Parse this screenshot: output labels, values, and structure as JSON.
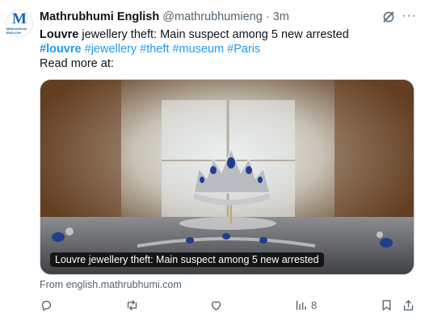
{
  "account": {
    "avatar_letter": "M",
    "avatar_subtext": "Mathrubhumi ENGLISH",
    "name": "Mathrubhumi English",
    "handle": "@mathrubhumieng",
    "separator": " · ",
    "time": "3m"
  },
  "tweet": {
    "title_bold": "Louvre",
    "title_rest": " jewellery theft: Main suspect among 5 new arrested",
    "hashtags": [
      "#louvre",
      "#jewellery",
      "#theft",
      "#museum",
      "#Paris"
    ],
    "read_more": "Read more at:"
  },
  "card": {
    "caption": "Louvre jewellery theft: Main suspect among 5 new arrested",
    "source": "From english.mathrubhumi.com"
  },
  "actions": {
    "views_count": "8"
  },
  "icons": [
    "grok-icon",
    "more-icon",
    "reply-icon",
    "retweet-icon",
    "like-icon",
    "views-icon",
    "bookmark-icon",
    "share-icon"
  ],
  "colors": {
    "link": "#1d9bf0",
    "muted": "#536471",
    "brand": "#1166b3"
  }
}
